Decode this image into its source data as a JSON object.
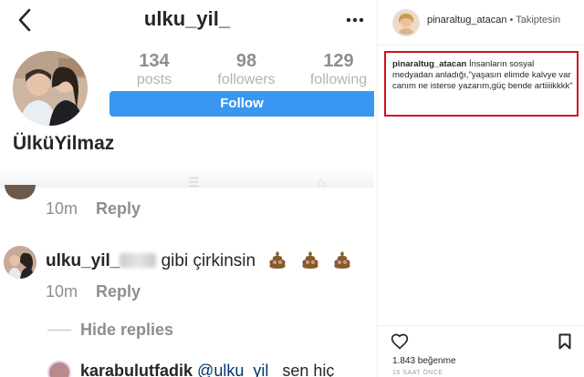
{
  "profile": {
    "username": "ulku_yil_",
    "display_name": "ÜlküYilmaz",
    "stats": {
      "posts": {
        "count": "134",
        "label": "posts"
      },
      "followers": {
        "count": "98",
        "label": "followers"
      },
      "following": {
        "count": "129",
        "label": "following"
      }
    },
    "follow_label": "Follow"
  },
  "comments": {
    "first": {
      "time": "10m",
      "reply_label": "Reply"
    },
    "second": {
      "username": "ulku_yil_",
      "text": "gibi çirkinsin",
      "time": "10m",
      "reply_label": "Reply"
    },
    "hide_replies_label": "Hide replies",
    "reply_preview": {
      "username": "karabulutfadik",
      "mention": "@ulku_yil_",
      "text": "sen hiç"
    }
  },
  "post": {
    "header_user": "pinaraltug_atacan",
    "header_separator": " • ",
    "header_status": "Takiptesin",
    "caption_user": "pinaraltug_atacan",
    "caption_text": " İnsanların sosyal medyadan anladığı,\"yaşasın elimde kalvye var canım ne isterse yazarım,güç bende artiiiikkkk\"",
    "likes": "1.843 beğenme",
    "time_ago": "16 SAAT ÖNCE"
  },
  "colors": {
    "follow_button": "#3897f0",
    "highlight_box": "#d0101b"
  }
}
